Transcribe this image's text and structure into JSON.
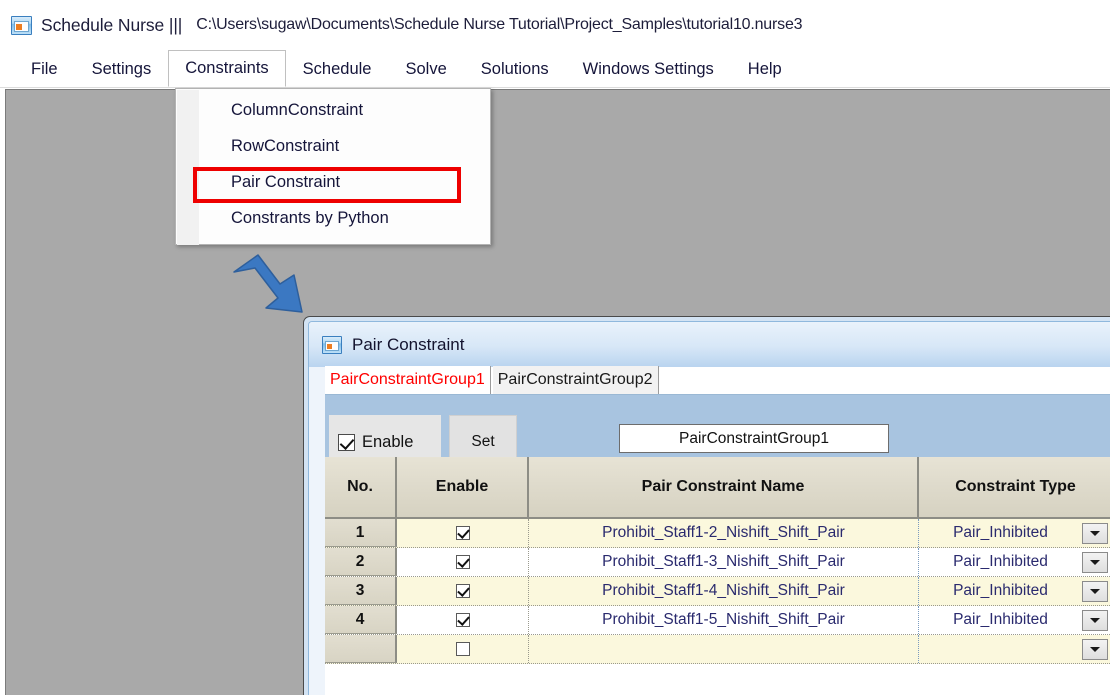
{
  "app": {
    "title": "Schedule Nurse |||",
    "file_path": "C:\\Users\\sugaw\\Documents\\Schedule Nurse Tutorial\\Project_Samples\\tutorial10.nurse3",
    "icon": "app-window-icon"
  },
  "menubar": {
    "items": [
      {
        "label": "File",
        "open": false
      },
      {
        "label": "Settings",
        "open": false
      },
      {
        "label": "Constraints",
        "open": true
      },
      {
        "label": "Schedule",
        "open": false
      },
      {
        "label": "Solve",
        "open": false
      },
      {
        "label": "Solutions",
        "open": false
      },
      {
        "label": "Windows Settings",
        "open": false
      },
      {
        "label": "Help",
        "open": false
      }
    ]
  },
  "dropdown": {
    "items": [
      {
        "label": "ColumnConstraint",
        "highlighted": false
      },
      {
        "label": "RowConstraint",
        "highlighted": false
      },
      {
        "label": "Pair Constraint",
        "highlighted": true
      },
      {
        "label": "Constrants by Python",
        "highlighted": false
      }
    ],
    "highlight_color": "#ee0000"
  },
  "annotation": {
    "arrow": "blue-down-right-arrow",
    "arrow_color": "#3b78c2"
  },
  "dialog": {
    "title": "Pair Constraint",
    "icon": "dialog-window-icon",
    "tabs": [
      {
        "label": "PairConstraintGroup1",
        "active": true
      },
      {
        "label": "PairConstraintGroup2",
        "active": false
      }
    ],
    "active_tab_color": "#ff0000",
    "toolbar": {
      "enable_label": "Enable",
      "enable_checked": true,
      "set_label": "Set",
      "group_name_value": "PairConstraintGroup1"
    },
    "grid": {
      "columns": [
        "No.",
        "Enable",
        "Pair Constraint Name",
        "Constraint Type"
      ],
      "rows": [
        {
          "no": "1",
          "enabled": true,
          "name": "Prohibit_Staff1-2_Nishift_Shift_Pair",
          "type": "Pair_Inhibited"
        },
        {
          "no": "2",
          "enabled": true,
          "name": "Prohibit_Staff1-3_Nishift_Shift_Pair",
          "type": "Pair_Inhibited"
        },
        {
          "no": "3",
          "enabled": true,
          "name": "Prohibit_Staff1-4_Nishift_Shift_Pair",
          "type": "Pair_Inhibited"
        },
        {
          "no": "4",
          "enabled": true,
          "name": "Prohibit_Staff1-5_Nishift_Shift_Pair",
          "type": "Pair_Inhibited"
        },
        {
          "no": "",
          "enabled": true,
          "name": "",
          "type": ""
        }
      ]
    }
  }
}
